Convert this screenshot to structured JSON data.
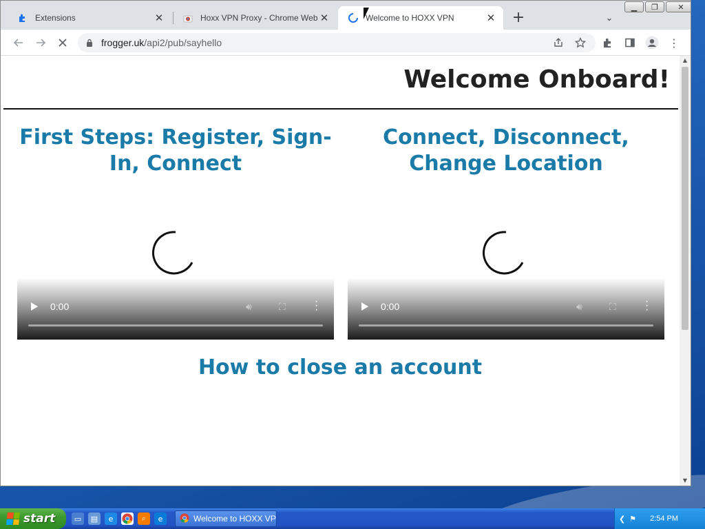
{
  "browser": {
    "tabs": [
      {
        "title": "Extensions",
        "icon": "puzzle-icon",
        "active": false
      },
      {
        "title": "Hoxx VPN Proxy - Chrome Web Store",
        "icon": "chrome-web-store-icon",
        "active": false
      },
      {
        "title": "Welcome to HOXX VPN",
        "icon": "loading-spinner-icon",
        "active": true
      }
    ],
    "new_tab_label": "+",
    "omnibox": {
      "host": "frogger.uk",
      "path": "/api2/pub/sayhello"
    },
    "window_controls": [
      "minimize",
      "restore",
      "close"
    ]
  },
  "page": {
    "welcome_heading": "Welcome Onboard!",
    "sections": [
      {
        "title": "First Steps: Register, Sign-In, Connect"
      },
      {
        "title": "Connect, Disconnect, Change Location"
      },
      {
        "title": "How to close an account"
      }
    ],
    "videos": [
      {
        "time": "0:00"
      },
      {
        "time": "0:00"
      }
    ]
  },
  "taskbar": {
    "start_label": "start",
    "active_window": "Welcome to HOXX VPN...",
    "clock": "2:54 PM"
  },
  "colors": {
    "section_title": "#1a7aa8",
    "heading": "#222222",
    "taskbar": "#2353c4",
    "start": "#3c9a2e"
  }
}
